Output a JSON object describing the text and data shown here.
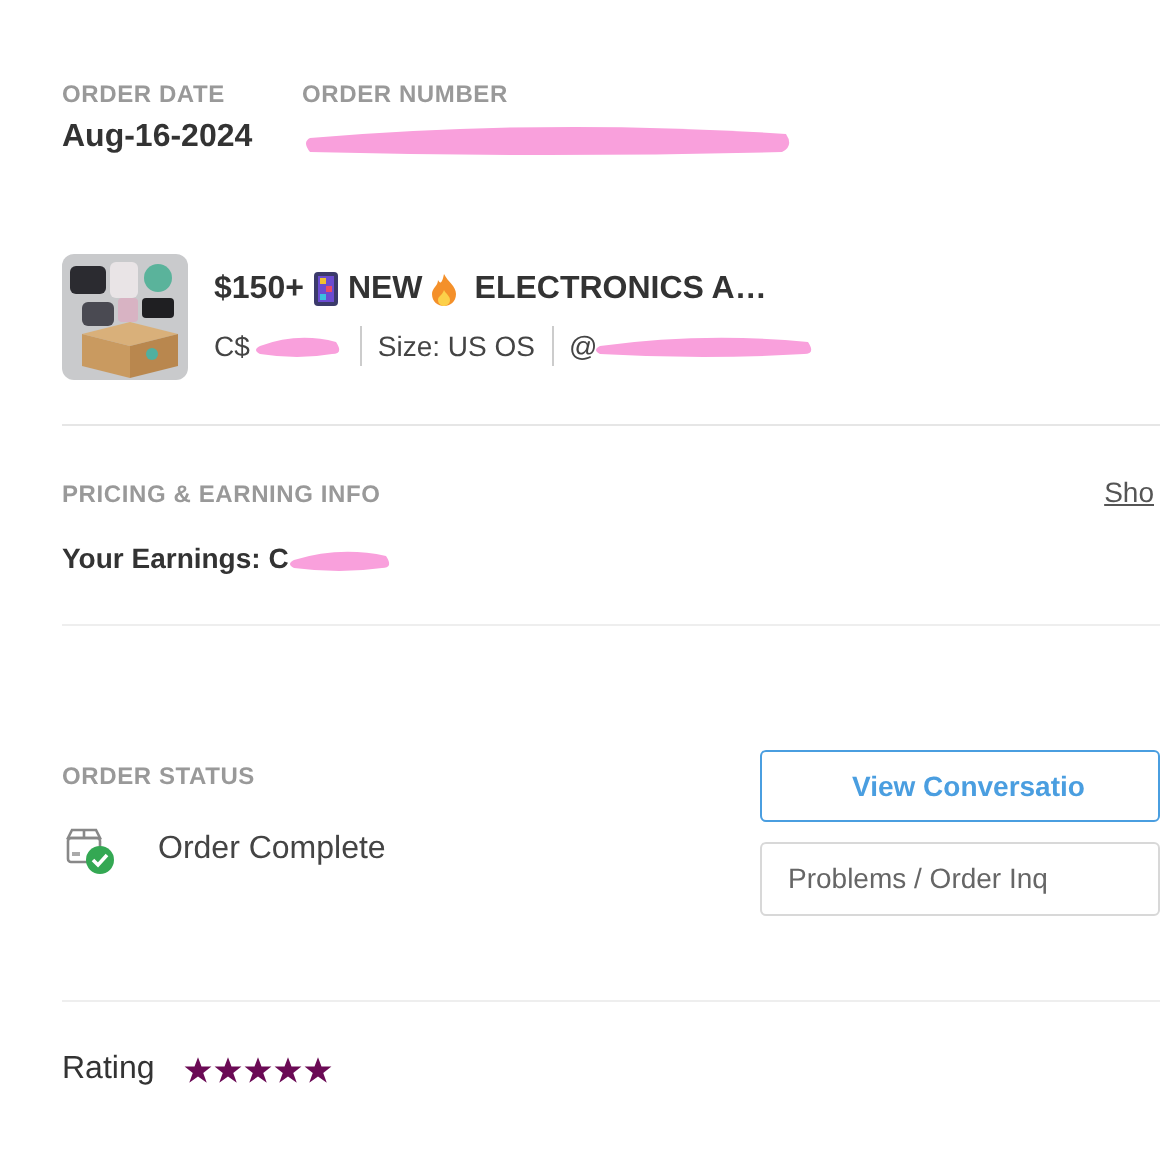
{
  "order_info": {
    "date_label": "ORDER DATE",
    "date": "Aug-16-2024",
    "number_label": "ORDER NUMBER"
  },
  "product": {
    "title_segments": [
      "$150+",
      "NEW",
      "ELECTRONICS A…"
    ],
    "price": "C$",
    "size": "Size: US OS",
    "seller": "@"
  },
  "pricing": {
    "heading": "PRICING & EARNING INFO",
    "link": "Sho",
    "earnings": "Your Earnings: C"
  },
  "status": {
    "heading": "ORDER STATUS",
    "value": "Order Complete",
    "complete": true
  },
  "buttons": [
    {
      "label": "View Conversatio",
      "kind": "primary"
    },
    {
      "label": "Problems / Order Inq",
      "kind": "secondary"
    }
  ],
  "rating": {
    "label": "Rating",
    "stars": 5
  }
}
